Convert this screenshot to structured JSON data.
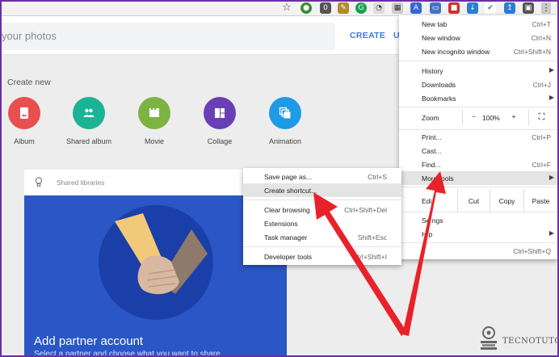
{
  "search": {
    "placeholder": "your photos"
  },
  "appbar": {
    "create_label": "CREATE",
    "upload_label": "U"
  },
  "create_new": {
    "heading": "Create new",
    "items": [
      {
        "label": "Album",
        "icon": "album-icon",
        "color": "#e94f4f"
      },
      {
        "label": "Shared album",
        "icon": "people-icon",
        "color": "#1ab394"
      },
      {
        "label": "Movie",
        "icon": "movie-icon",
        "color": "#7cb342"
      },
      {
        "label": "Collage",
        "icon": "collage-icon",
        "color": "#6a3fb5"
      },
      {
        "label": "Animation",
        "icon": "animation-icon",
        "color": "#1e9ae6"
      }
    ]
  },
  "card": {
    "header": "Shared libraries",
    "title": "Add partner account",
    "subtitle": "Select a partner and choose what you want to share",
    "color": "#2a56c6"
  },
  "chrome_menu": {
    "new_tab": {
      "label": "New tab",
      "shortcut": "Ctrl+T"
    },
    "new_window": {
      "label": "New window",
      "shortcut": "Ctrl+N"
    },
    "new_incognito": {
      "label": "New incognito window",
      "shortcut": "Ctrl+Shift+N"
    },
    "history": {
      "label": "History"
    },
    "downloads": {
      "label": "Downloads",
      "shortcut": "Ctrl+J"
    },
    "bookmarks": {
      "label": "Bookmarks"
    },
    "zoom": {
      "label": "Zoom",
      "minus": "−",
      "value": "100%",
      "plus": "+",
      "fullscreen": "⛶"
    },
    "print": {
      "label": "Print...",
      "shortcut": "Ctrl+P"
    },
    "cast": {
      "label": "Cast..."
    },
    "find": {
      "label": "Find...",
      "shortcut": "Ctrl+F"
    },
    "more_tools": {
      "label": "More tools"
    },
    "edit": {
      "label": "Edi",
      "cut": "Cut",
      "copy": "Copy",
      "paste": "Paste"
    },
    "settings": {
      "label": "Se  ngs"
    },
    "help": {
      "label": "H  p"
    },
    "exit": {
      "label": "it",
      "shortcut": "Ctrl+Shift+Q"
    }
  },
  "submenu": {
    "save_page": {
      "label": "Save page as...",
      "shortcut": "Ctrl+S"
    },
    "create_shortcut": {
      "label": "Create shortcut..."
    },
    "clear_browsing": {
      "label": "Clear browsing",
      "shortcut": "Ctrl+Shift+Del"
    },
    "extensions": {
      "label": "Extensions"
    },
    "task_manager": {
      "label": "Task manager",
      "shortcut": "Shift+Esc"
    },
    "developer_tools": {
      "label": "Developer tools",
      "shortcut": "Ctrl+Shift+I"
    }
  },
  "watermark": {
    "text": "TECNOTUTO"
  },
  "colors": {
    "accent": "#3b78e7",
    "arrow": "#e8222a",
    "frame": "#6b2fa0"
  }
}
